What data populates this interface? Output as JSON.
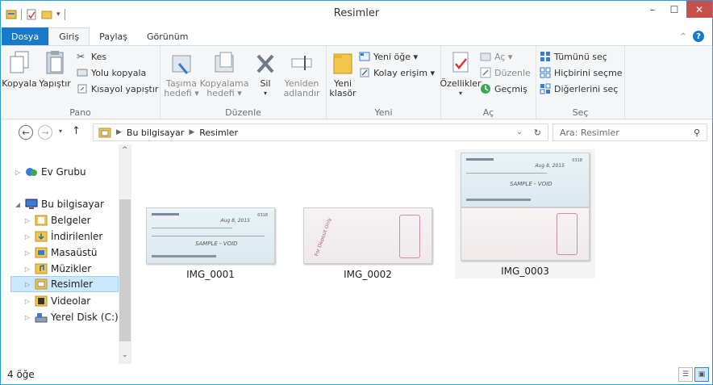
{
  "window": {
    "title": "Resimler",
    "minimize": "–",
    "maximize": "☐",
    "close": "✕"
  },
  "tabs": [
    "Dosya",
    "Giriş",
    "Paylaş",
    "Görünüm"
  ],
  "ribbon": {
    "pano": {
      "label": "Pano",
      "copy": "Kopyala",
      "paste": "Yapıştır",
      "cut": "Kes",
      "copy_path": "Yolu kopyala",
      "paste_shortcut": "Kısayol yapıştır"
    },
    "duzenle": {
      "label": "Düzenle",
      "move_to": "Taşıma hedefi ▾",
      "copy_to": "Kopyalama hedefi ▾",
      "delete": "Sil",
      "rename": "Yeniden adlandır"
    },
    "yeni": {
      "label": "Yeni",
      "new_folder": "Yeni klasör",
      "new_item": "Yeni öğe ▾",
      "easy_access": "Kolay erişim ▾"
    },
    "ac": {
      "label": "Aç",
      "properties": "Özellikler",
      "open": "Aç ▾",
      "edit": "Düzenle",
      "history": "Geçmiş"
    },
    "sec": {
      "label": "Seç",
      "select_all": "Tümünü seç",
      "select_none": "Hiçbirini seçme",
      "invert": "Diğerlerini seç"
    }
  },
  "address": {
    "path": [
      "Bu bilgisayar",
      "Resimler"
    ],
    "search_placeholder": "Ara: Resimler"
  },
  "nav": {
    "homegroup": "Ev Grubu",
    "this_pc": "Bu bilgisayar",
    "items": [
      "Belgeler",
      "İndirilenler",
      "Masaüstü",
      "Müzikler",
      "Resimler",
      "Videolar",
      "Yerel Disk (C:)"
    ]
  },
  "files": [
    {
      "name": "IMG_0001",
      "sample": "SAMPLE - VOID",
      "date": "Aug 8, 2015"
    },
    {
      "name": "IMG_0002",
      "stamp": "For Deposit Only"
    },
    {
      "name": "IMG_0003",
      "sample": "SAMPLE - VOID",
      "date": "Aug 8, 2015"
    }
  ],
  "status": {
    "count": "4 öğe"
  }
}
